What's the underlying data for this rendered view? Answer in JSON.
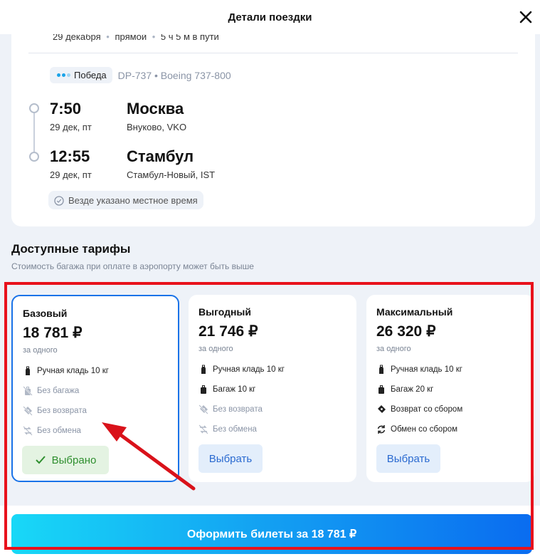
{
  "header": {
    "title": "Детали поездки",
    "close_icon": "close-icon"
  },
  "flight": {
    "summary": {
      "date": "29 декабря",
      "type": "прямой",
      "duration": "5 ч 5 м в пути",
      "separator": "•"
    },
    "airline": {
      "name": "Победа",
      "logo_colors": [
        "#1aa3e8",
        "#1aa3e8",
        "#9fd4f2"
      ],
      "flight_number": "DP-737",
      "separator": "•",
      "aircraft": "Boeing 737-800"
    },
    "departure": {
      "time": "7:50",
      "date": "29 дек, пт",
      "city": "Москва",
      "airport": "Внуково, VKO"
    },
    "arrival": {
      "time": "12:55",
      "date": "29 дек, пт",
      "city": "Стамбул",
      "airport": "Стамбул-Новый, IST"
    },
    "local_time_note": "Везде указано местное время"
  },
  "tariffs": {
    "title": "Доступные тарифы",
    "subtitle": "Стоимость багажа при оплате в аэропорту может быть выше",
    "items": [
      {
        "name": "Базовый",
        "price": "18 781 ₽",
        "per": "за одного",
        "selected": true,
        "button_label": "Выбрано",
        "features": [
          {
            "icon": "hand-luggage-icon",
            "label": "Ручная кладь 10 кг",
            "included": true
          },
          {
            "icon": "no-baggage-icon",
            "label": "Без багажа",
            "included": false
          },
          {
            "icon": "no-refund-icon",
            "label": "Без возврата",
            "included": false
          },
          {
            "icon": "no-exchange-icon",
            "label": "Без обмена",
            "included": false
          }
        ]
      },
      {
        "name": "Выгодный",
        "price": "21 746 ₽",
        "per": "за одного",
        "selected": false,
        "button_label": "Выбрать",
        "features": [
          {
            "icon": "hand-luggage-icon",
            "label": "Ручная кладь 10 кг",
            "included": true
          },
          {
            "icon": "baggage-icon",
            "label": "Багаж 10 кг",
            "included": true
          },
          {
            "icon": "no-refund-icon",
            "label": "Без возврата",
            "included": false
          },
          {
            "icon": "no-exchange-icon",
            "label": "Без обмена",
            "included": false
          }
        ]
      },
      {
        "name": "Максимальный",
        "price": "26 320 ₽",
        "per": "за одного",
        "selected": false,
        "button_label": "Выбрать",
        "features": [
          {
            "icon": "hand-luggage-icon",
            "label": "Ручная кладь 10 кг",
            "included": true
          },
          {
            "icon": "baggage-icon",
            "label": "Багаж 20 кг",
            "included": true
          },
          {
            "icon": "refund-icon",
            "label": "Возврат со сбором",
            "included": true
          },
          {
            "icon": "exchange-icon",
            "label": "Обмен со сбором",
            "included": true
          }
        ]
      }
    ]
  },
  "checkout": {
    "label": "Оформить билеты за 18 781 ₽"
  },
  "colors": {
    "accent": "#1a73e8",
    "selected_green": "#2f8f2f",
    "annotation_red": "#e8121c"
  }
}
